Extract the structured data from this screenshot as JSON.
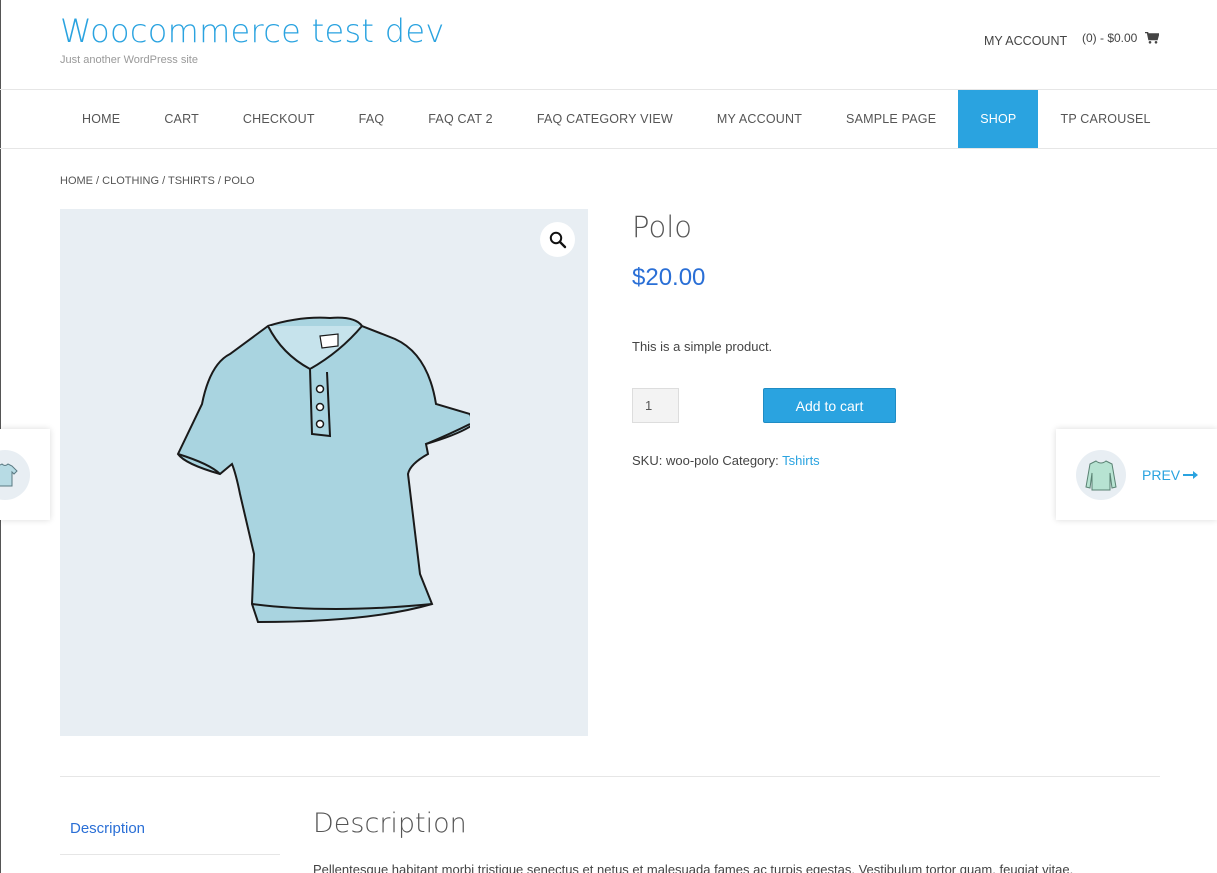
{
  "header": {
    "site_title": "Woocommerce test dev",
    "site_description": "Just another WordPress site",
    "account_link": "MY ACCOUNT",
    "cart_summary": "(0) - $0.00",
    "cart_icon": "shopping-cart-icon"
  },
  "nav": {
    "items": [
      {
        "label": "HOME"
      },
      {
        "label": "CART"
      },
      {
        "label": "CHECKOUT"
      },
      {
        "label": "FAQ"
      },
      {
        "label": "FAQ CAT 2"
      },
      {
        "label": "FAQ CATEGORY VIEW"
      },
      {
        "label": "MY ACCOUNT"
      },
      {
        "label": "SAMPLE PAGE"
      },
      {
        "label": "SHOP"
      },
      {
        "label": "TP CAROUSEL"
      }
    ],
    "active": "SHOP",
    "active_color": "#2aa3e0"
  },
  "breadcrumb": {
    "home": "HOME",
    "clothing": "CLOTHING",
    "tshirts": "TSHIRTS",
    "current": "POLO",
    "separator": " / "
  },
  "product": {
    "title": "Polo",
    "price": "$20.00",
    "short_description": "This is a simple product.",
    "quantity": "1",
    "add_to_cart_label": "Add to cart",
    "sku_label": "SKU:",
    "sku": "woo-polo",
    "category_label": "Category:",
    "category": "Tshirts",
    "zoom_icon": "magnifier-icon",
    "image_icon": "polo-shirt-image"
  },
  "side_nav": {
    "prev_label": "PREV",
    "arrow_icon": "arrow-right-icon"
  },
  "tabs": {
    "description_tab": "Description",
    "description_heading": "Description",
    "description_text": "Pellentesque habitant morbi tristique senectus et netus et malesuada fames ac turpis egestas. Vestibulum tortor quam, feugiat vitae,"
  },
  "colors": {
    "accent": "#2aa3e0",
    "price": "#2a6fd6"
  }
}
